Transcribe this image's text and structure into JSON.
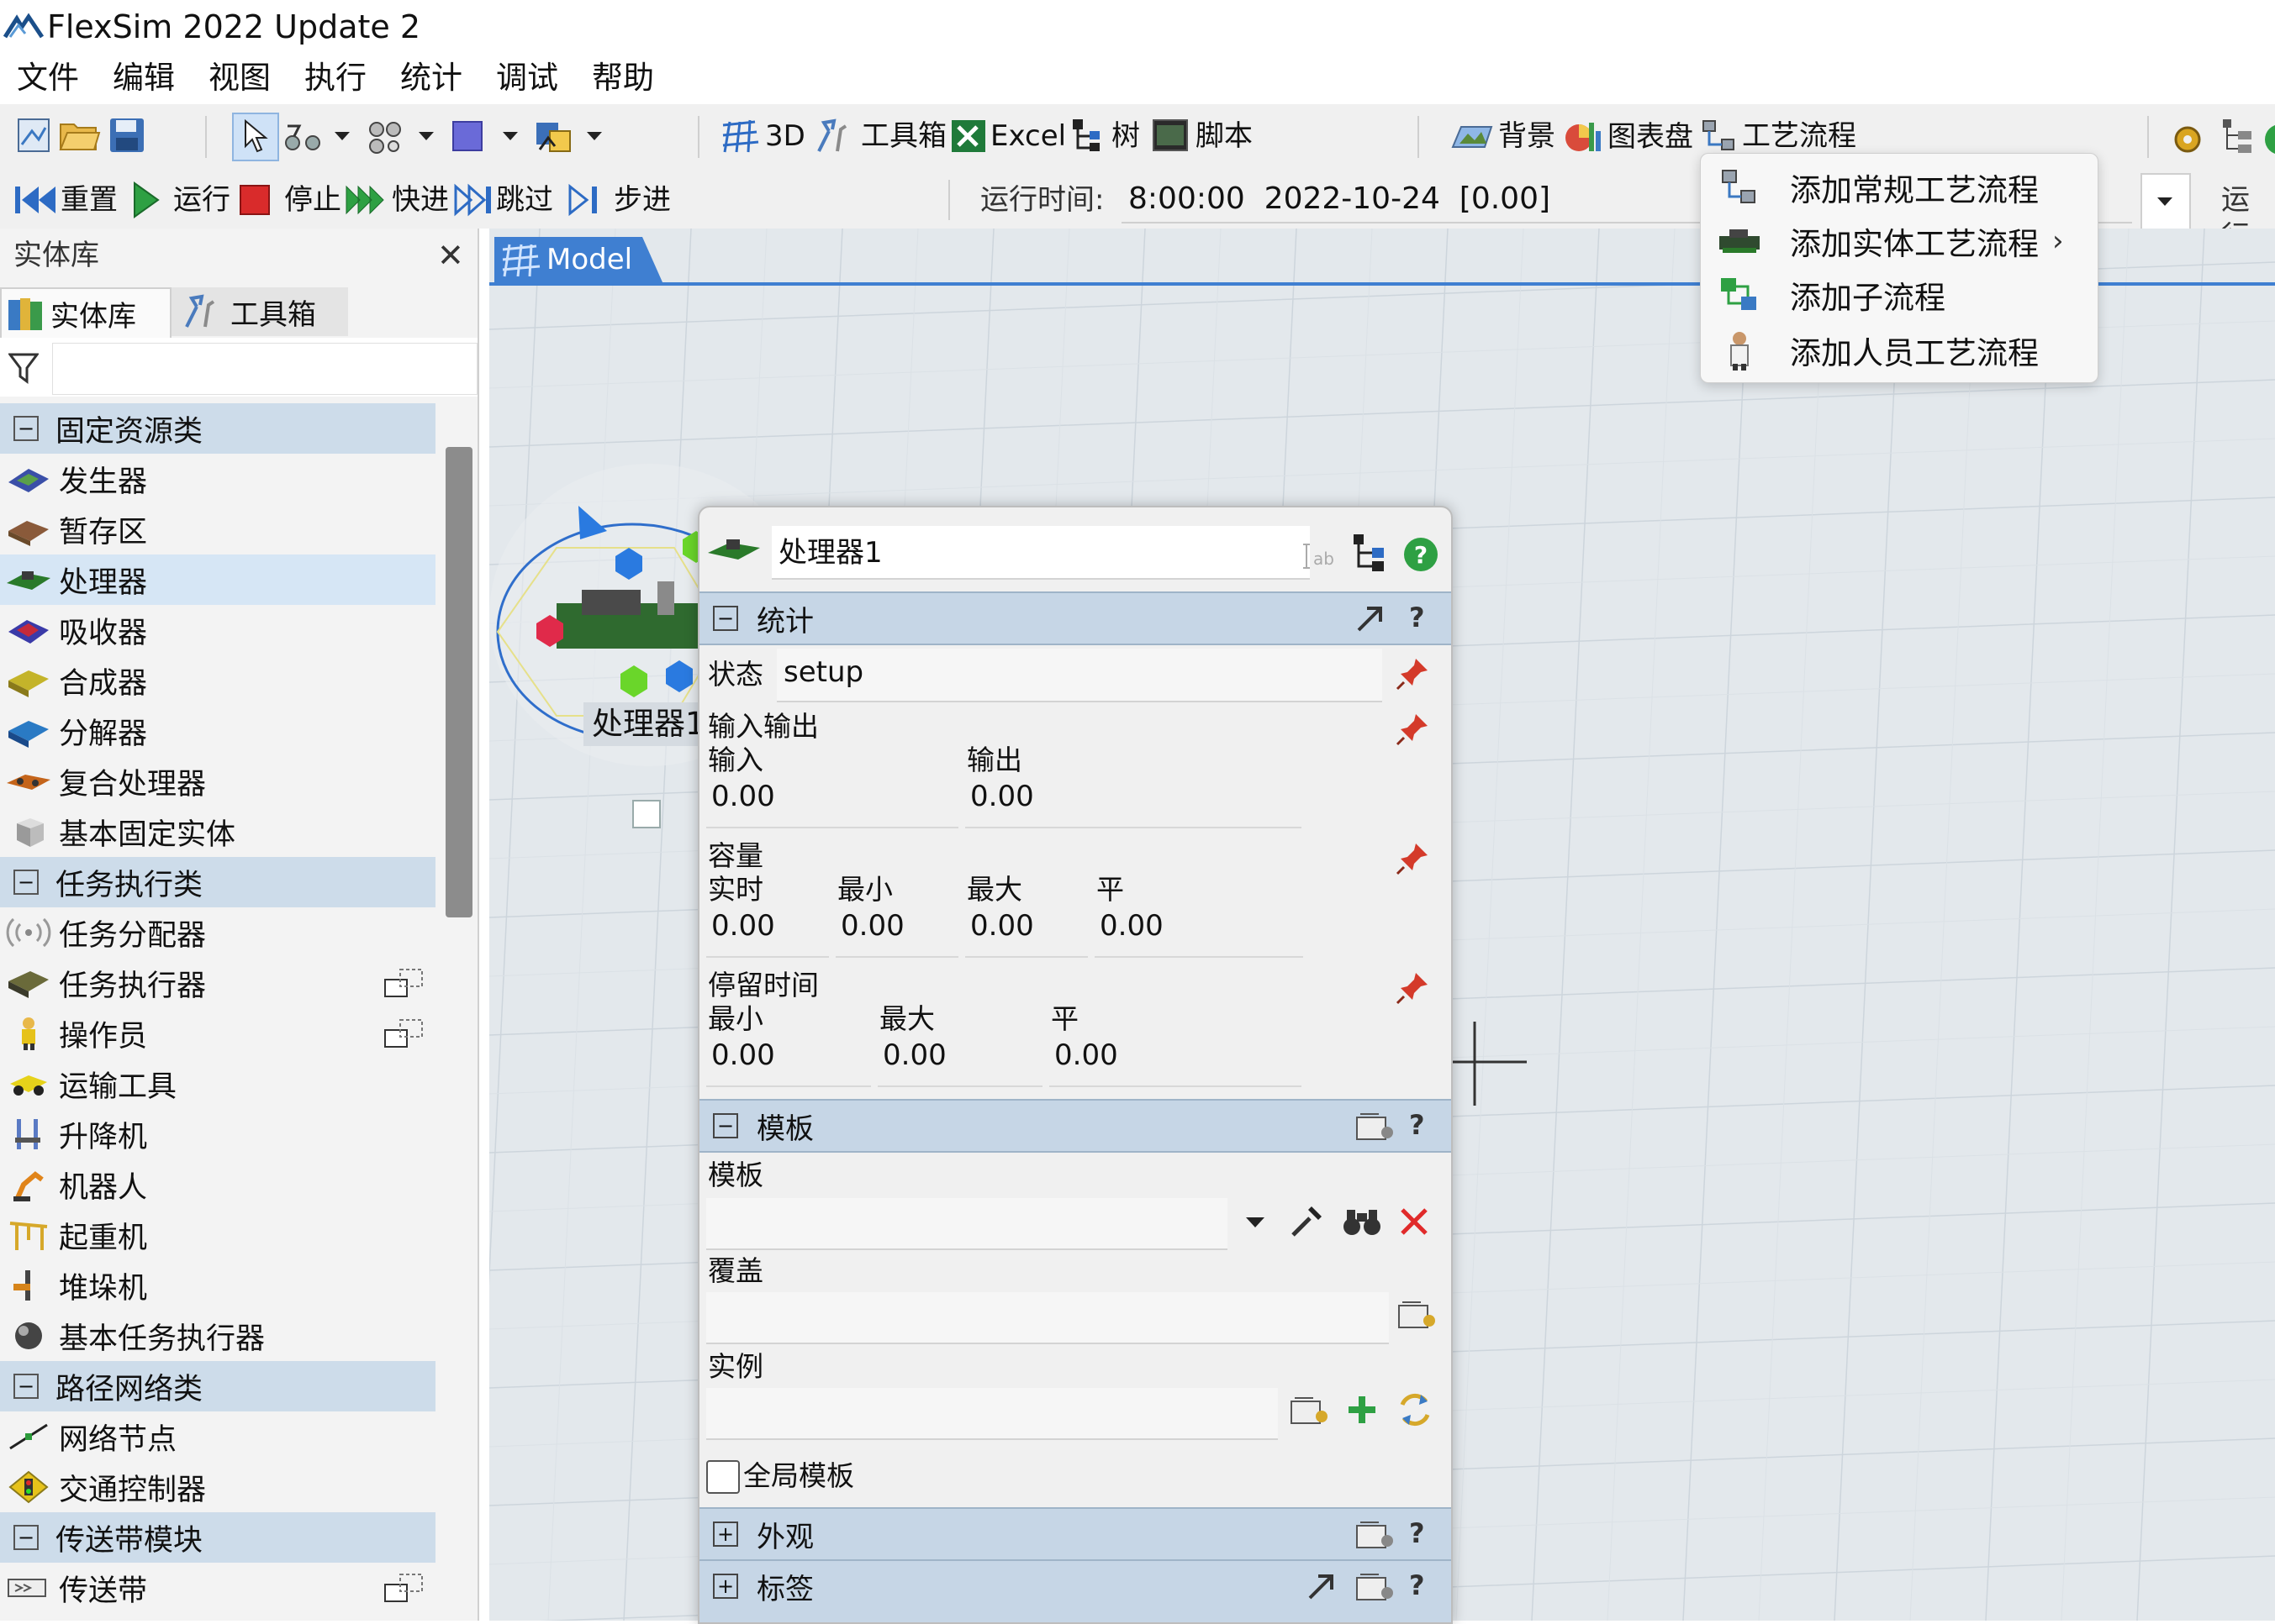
{
  "window": {
    "title": "FlexSim 2022 Update 2"
  },
  "menubar": [
    "文件",
    "编辑",
    "视图",
    "执行",
    "统计",
    "调试",
    "帮助"
  ],
  "toolbar_main": {
    "btn_3d": "3D",
    "btn_toolbox": "工具箱",
    "btn_excel": "Excel",
    "btn_tree": "树",
    "btn_script": "脚本",
    "btn_background": "背景",
    "btn_dashboard": "图表盘",
    "btn_process_flow": "工艺流程"
  },
  "toolbar_run": {
    "reset": "重置",
    "run": "运行",
    "stop": "停止",
    "fast": "快进",
    "skip": "跳过",
    "step": "步进",
    "run_time_label": "运行时间:",
    "run_time_value": "8:00:00  2022-10-24  [0.00]",
    "run_right": "运行"
  },
  "library_panel": {
    "title": "实体库",
    "tabs": [
      "实体库",
      "工具箱"
    ],
    "categories": {
      "fixed": "固定资源类",
      "task": "任务执行类",
      "network": "路径网络类",
      "conveyor": "传送带模块"
    },
    "fixed_items": [
      "发生器",
      "暂存区",
      "处理器",
      "吸收器",
      "合成器",
      "分解器",
      "复合处理器",
      "基本固定实体"
    ],
    "task_items": [
      "任务分配器",
      "任务执行器",
      "操作员",
      "运输工具",
      "升降机",
      "机器人",
      "起重机",
      "堆垛机",
      "基本任务执行器"
    ],
    "network_items": [
      "网络节点",
      "交通控制器"
    ],
    "conveyor_items": [
      "传送带"
    ]
  },
  "model_tab": {
    "label": "Model"
  },
  "model_object_label": "处理器1",
  "properties": {
    "name": "处理器1",
    "statistics": {
      "header": "统计",
      "state_label": "状态",
      "state_value": "setup",
      "io_label": "输入输出",
      "input_label": "输入",
      "output_label": "输出",
      "input_value": "0.00",
      "output_value": "0.00",
      "capacity_label": "容量",
      "cap_current_label": "实时",
      "cap_min_label": "最小",
      "cap_max_label": "最大",
      "cap_avg_label": "平",
      "cap_current": "0.00",
      "cap_min": "0.00",
      "cap_max": "0.00",
      "cap_avg": "0.00",
      "stay_label": "停留时间",
      "stay_min_label": "最小",
      "stay_max_label": "最大",
      "stay_avg_label": "平",
      "stay_min": "0.00",
      "stay_max": "0.00",
      "stay_avg": "0.00"
    },
    "template": {
      "header": "模板",
      "template_label": "模板",
      "override_label": "覆盖",
      "instance_label": "实例",
      "global_template_label": "全局模板",
      "global_template_checked": false
    },
    "appearance_header": "外观",
    "labels_header": "标签"
  },
  "context_menu": {
    "items": [
      "添加常规工艺流程",
      "添加实体工艺流程",
      "添加子流程",
      "添加人员工艺流程"
    ],
    "submenu_arrow": "›"
  }
}
